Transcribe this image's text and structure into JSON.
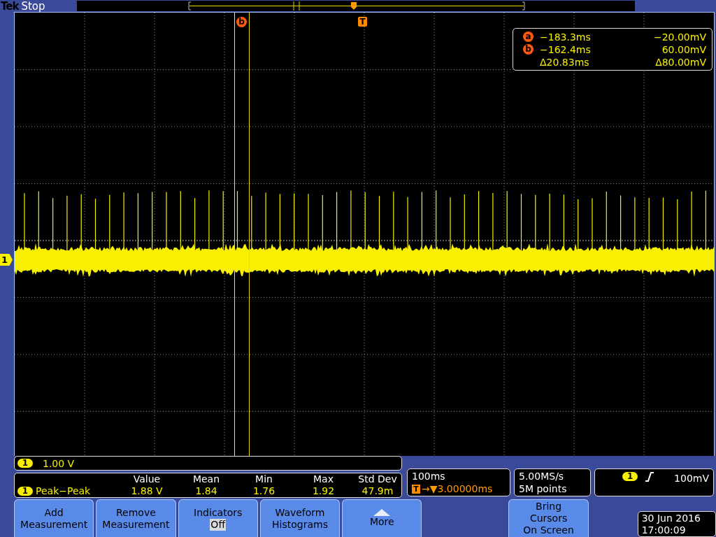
{
  "status_bar": {
    "brand": "Tek",
    "acquisition": "Stop"
  },
  "graticule": {
    "cursor_marker": "b",
    "trigger_marker": "T",
    "channel_marker": "1"
  },
  "cursor_readout": [
    {
      "kind": "cursor",
      "marker": "a",
      "time": "−183.3ms",
      "voltage": "−20.00mV"
    },
    {
      "kind": "cursor",
      "marker": "b",
      "time": "−162.4ms",
      "voltage": "60.00mV"
    },
    {
      "kind": "delta",
      "time": "Δ20.83ms",
      "voltage": "Δ80.00mV"
    }
  ],
  "scale": {
    "channel": "1",
    "value": "1.00 V"
  },
  "measurements": {
    "columns": [
      "Value",
      "Mean",
      "Min",
      "Max",
      "Std Dev"
    ],
    "rows": [
      {
        "channel": "1",
        "name": "Peak−Peak",
        "cells": [
          "1.88 V",
          "1.84",
          "1.76",
          "1.92",
          "47.9m"
        ]
      }
    ]
  },
  "timebase": {
    "scale": "100ms",
    "trigger_marker": "T",
    "delay": "→▼3.00000ms"
  },
  "acquisition": {
    "sample_rate": "5.00MS/s",
    "record_length": "5M points"
  },
  "trigger": {
    "channel": "1",
    "level": "100mV"
  },
  "buttons": [
    {
      "kind": "plain",
      "label": "Add\nMeasurement"
    },
    {
      "kind": "plain",
      "label": "Remove\nMeasurement"
    },
    {
      "kind": "state",
      "label": "Indicators",
      "value": "Off"
    },
    {
      "kind": "plain",
      "label": "Waveform\nHistograms"
    },
    {
      "kind": "more",
      "label": "More"
    }
  ],
  "side_button": {
    "label": "Bring\nCursors\nOn Screen"
  },
  "datetime": {
    "date": "30 Jun 2016",
    "time": "17:00:09"
  }
}
